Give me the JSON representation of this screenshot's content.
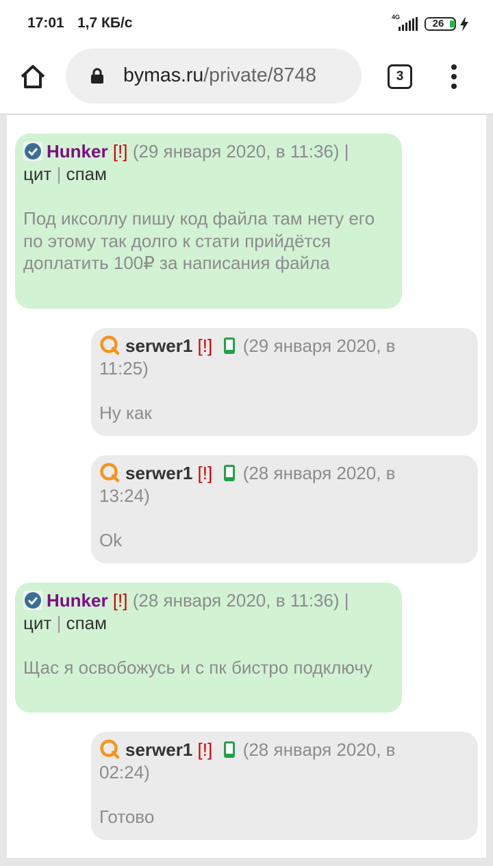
{
  "status_bar": {
    "time": "17:01",
    "net_speed": "1,7 КБ/с",
    "network_type": "4G",
    "battery": "26",
    "icons": [
      "signal-icon",
      "battery-icon",
      "charging-icon"
    ]
  },
  "browser": {
    "url_host": "bymas.ru",
    "url_path": "/private/8748",
    "tab_count": "3",
    "icons": [
      "home-icon",
      "lock-icon",
      "overflow-menu-icon"
    ]
  },
  "colors": {
    "own_message_bg": "#d2f2d4",
    "other_message_bg": "#ebebeb",
    "hunker_nick": "#7c0f83",
    "warn_mark": "#d10000"
  },
  "messages": [
    {
      "author": "Hunker",
      "warn": "[!]",
      "date": "(29 января 2020, в 11:36)",
      "action_sep": "|",
      "quote": "цит",
      "spam": "спам",
      "body": "Под иксоллу пишу код файла там нету его по этому так долго к стати прийдётся доплатить 100₽ за написания файла"
    },
    {
      "author": "serwer1",
      "warn": "[!]",
      "date_part1": "(29 января 2020, в",
      "date_part2": "11:25)",
      "body": "Ну как"
    },
    {
      "author": "serwer1",
      "warn": "[!]",
      "date_part1": "(28 января 2020, в",
      "date_part2": "13:24)",
      "body": "Ok"
    },
    {
      "author": "Hunker",
      "warn": "[!]",
      "date": "(28 января 2020, в 11:36)",
      "action_sep": "|",
      "quote": "цит",
      "spam": "спам",
      "body": "Щас я освобожусь и с пк бистро подключу"
    },
    {
      "author": "serwer1",
      "warn": "[!]",
      "date_part1": "(28 января 2020, в",
      "date_part2": "02:24)",
      "body": "Готово"
    }
  ]
}
